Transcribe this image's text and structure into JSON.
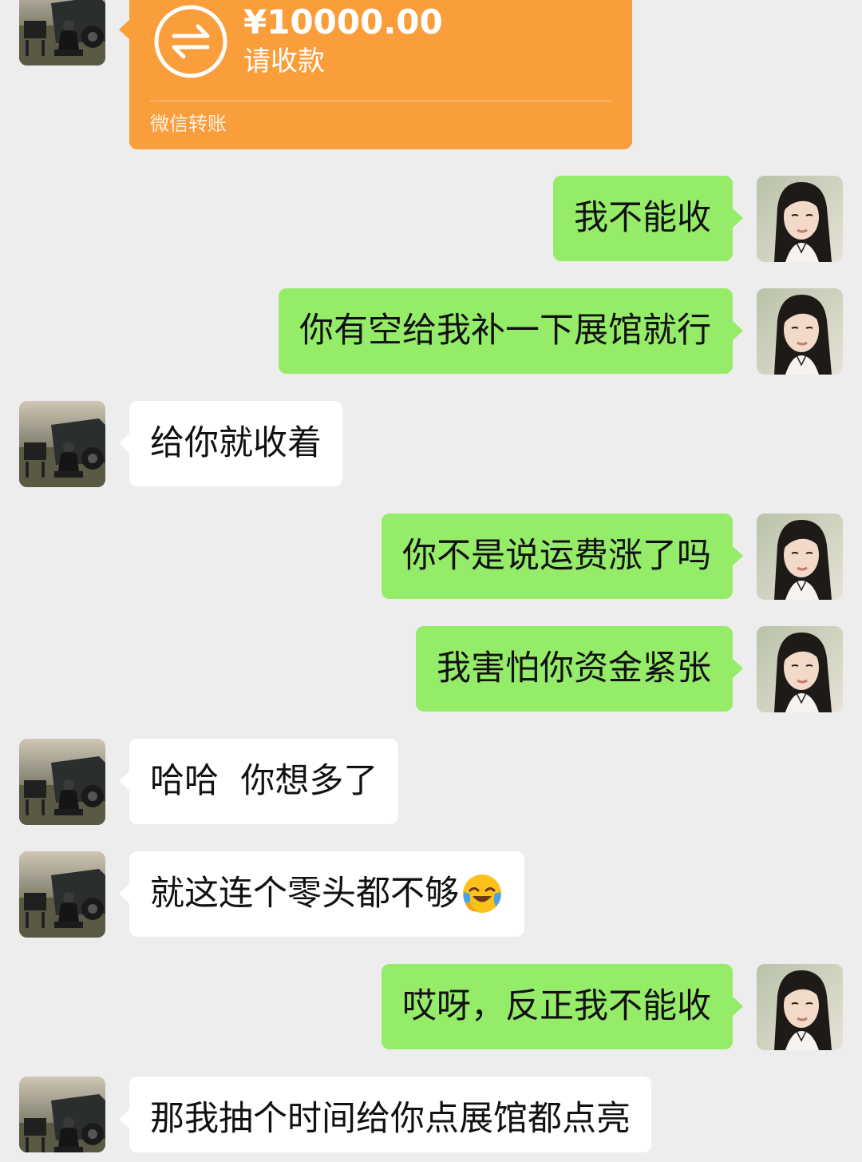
{
  "transfer": {
    "amount": "¥10000.00",
    "status": "请收款",
    "footer": "微信转账",
    "color": "#fa9d3b"
  },
  "colors": {
    "background": "#ededed",
    "sent_bubble": "#95ec69",
    "received_bubble": "#ffffff"
  },
  "messages": [
    {
      "side": "right",
      "text": "我不能收"
    },
    {
      "side": "right",
      "text": "你有空给我补一下展馆就行"
    },
    {
      "side": "left",
      "text": "给你就收着"
    },
    {
      "side": "right",
      "text": "你不是说运费涨了吗"
    },
    {
      "side": "right",
      "text": "我害怕你资金紧张"
    },
    {
      "side": "left",
      "text": "哈哈  你想多了"
    },
    {
      "side": "left",
      "text": "就这连个零头都不够",
      "emoji": "crying-laughing-emoji"
    },
    {
      "side": "right",
      "text": "哎呀，反正我不能收"
    },
    {
      "side": "left",
      "text": "那我抽个时间给你点展馆都点亮"
    }
  ]
}
